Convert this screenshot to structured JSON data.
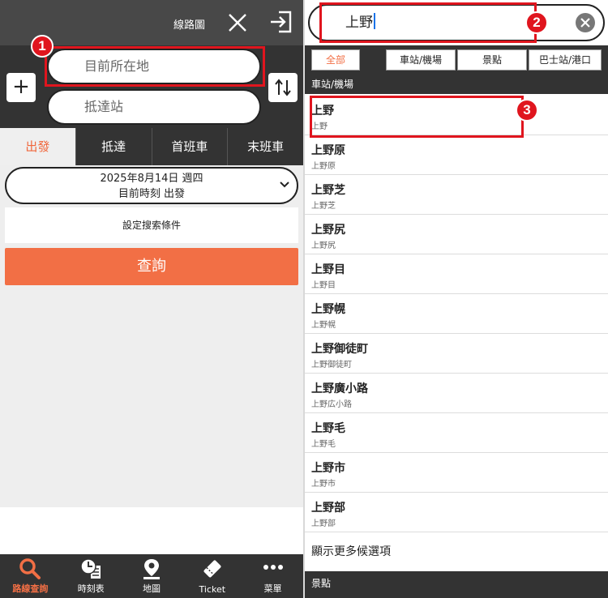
{
  "left": {
    "route_map_label": "線路圖",
    "add_label": "+",
    "from_placeholder": "目前所在地",
    "to_placeholder": "抵達站",
    "tabs": [
      {
        "label": "出發"
      },
      {
        "label": "抵達"
      },
      {
        "label": "首班車"
      },
      {
        "label": "末班車"
      }
    ],
    "date": "2025年8月14日 週四",
    "time_mode": "目前時刻 出發",
    "conditions_label": "設定搜索條件",
    "query_label": "查詢",
    "nav": [
      {
        "label": "路線查詢",
        "icon": "search-icon"
      },
      {
        "label": "時刻表",
        "icon": "clock-timetable-icon"
      },
      {
        "label": "地圖",
        "icon": "map-pin-icon"
      },
      {
        "label": "Ticket",
        "icon": "ticket-icon"
      },
      {
        "label": "菜單",
        "icon": "more-dots-icon"
      }
    ]
  },
  "right": {
    "search_value": "上野",
    "filters": [
      "全部",
      "車站/機場",
      "景點",
      "巴士站/港口"
    ],
    "section_stations": "車站/機場",
    "results": [
      {
        "main": "上野",
        "sub": "上野"
      },
      {
        "main": "上野原",
        "sub": "上野原"
      },
      {
        "main": "上野芝",
        "sub": "上野芝"
      },
      {
        "main": "上野尻",
        "sub": "上野尻"
      },
      {
        "main": "上野目",
        "sub": "上野目"
      },
      {
        "main": "上野幌",
        "sub": "上野幌"
      },
      {
        "main": "上野御徒町",
        "sub": "上野御徒町"
      },
      {
        "main": "上野廣小路",
        "sub": "上野広小路"
      },
      {
        "main": "上野毛",
        "sub": "上野毛"
      },
      {
        "main": "上野市",
        "sub": "上野市"
      },
      {
        "main": "上野部",
        "sub": "上野部"
      }
    ],
    "more_label": "顯示更多候選項",
    "section_spots": "景點"
  },
  "annotations": {
    "badge1": "1",
    "badge2": "2",
    "badge3": "3"
  },
  "colors": {
    "accent": "#f26f45",
    "highlight": "#e0151e",
    "dark": "#333333"
  }
}
